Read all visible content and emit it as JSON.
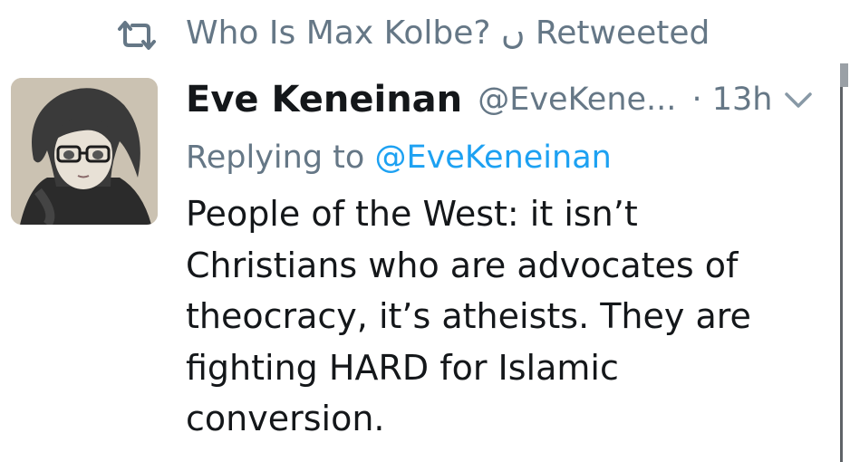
{
  "social_context": {
    "retweeter": "Who Is Max Kolbe? ں",
    "retweeted_label": "Retweeted",
    "icon": "retweet-icon"
  },
  "tweet": {
    "author_name": "Eve Keneinan",
    "author_handle": "@EveKene...",
    "separator": "·",
    "time": "13h",
    "reply_label": "Replying to",
    "reply_handle": "@EveKeneinan",
    "text": "People of the West: it isn’t Christians who are advocates of theocracy, it’s atheists. They are fighting HARD for Islamic conversion.",
    "menu_icon": "chevron-down-icon"
  },
  "colors": {
    "secondary_text": "#657786",
    "link": "#1da1f2",
    "primary_text": "#14171a"
  }
}
